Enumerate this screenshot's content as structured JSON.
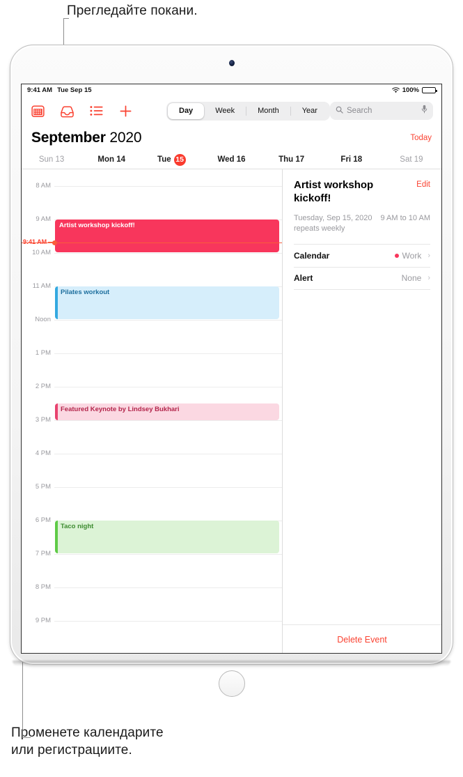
{
  "callouts": {
    "top": "Прегледайте покани.",
    "bottom": "Променете календарите\nили регистрациите."
  },
  "status_bar": {
    "time": "9:41 AM",
    "date": "Tue Sep 15",
    "wifi_icon": "wifi-icon",
    "battery_percent": "100%"
  },
  "toolbar": {
    "icons": [
      {
        "name": "calendars-icon",
        "label": "Calendars"
      },
      {
        "name": "inbox-icon",
        "label": "Inbox"
      },
      {
        "name": "list-icon",
        "label": "List"
      },
      {
        "name": "add-event-icon",
        "label": "Add Event"
      }
    ],
    "segments": [
      {
        "label": "Day",
        "active": true
      },
      {
        "label": "Week",
        "active": false
      },
      {
        "label": "Month",
        "active": false
      },
      {
        "label": "Year",
        "active": false
      }
    ],
    "search": {
      "placeholder": "Search",
      "search_icon": "search-icon",
      "mic_icon": "microphone-icon"
    }
  },
  "header": {
    "month": "September",
    "year": "2020",
    "today_label": "Today"
  },
  "weekdays": [
    {
      "label": "Sun 13",
      "name": "Sun",
      "num": "13",
      "dim": true,
      "selected": false
    },
    {
      "label": "Mon 14",
      "name": "Mon",
      "num": "14",
      "dim": false,
      "selected": false
    },
    {
      "label": "Tue 15",
      "name": "Tue",
      "num": "15",
      "dim": false,
      "selected": true
    },
    {
      "label": "Wed 16",
      "name": "Wed",
      "num": "16",
      "dim": false,
      "selected": false
    },
    {
      "label": "Thu 17",
      "name": "Thu",
      "num": "17",
      "dim": false,
      "selected": false
    },
    {
      "label": "Fri 18",
      "name": "Fri",
      "num": "18",
      "dim": false,
      "selected": false
    },
    {
      "label": "Sat 19",
      "name": "Sat",
      "num": "19",
      "dim": true,
      "selected": false
    }
  ],
  "day_grid": {
    "hours": [
      "8 AM",
      "9 AM",
      "10 AM",
      "11 AM",
      "Noon",
      "1 PM",
      "2 PM",
      "3 PM",
      "4 PM",
      "5 PM",
      "6 PM",
      "7 PM",
      "8 PM",
      "9 PM"
    ],
    "now_marker": {
      "label": "9:41 AM",
      "color": "#FA5C3C"
    },
    "events": [
      {
        "title": "Artist workshop kickoff!",
        "start": "9 AM",
        "end": "10 AM",
        "style": "selected",
        "fill": "#F8365C",
        "accent": "#F8365C"
      },
      {
        "title": "Pilates workout",
        "start": "11 AM",
        "end": "Noon",
        "style": "blue",
        "fill": "#D6EEFB",
        "accent": "#34A9E0"
      },
      {
        "title": "Featured Keynote by Lindsey Bukhari",
        "start": "2:30 PM",
        "end": "3 PM",
        "style": "pink",
        "fill": "#FBD8E2",
        "accent": "#E8436F"
      },
      {
        "title": "Taco night",
        "start": "6 PM",
        "end": "7 PM",
        "style": "green",
        "fill": "#DCF3D6",
        "accent": "#5FCB47"
      }
    ]
  },
  "detail": {
    "title": "Artist workshop kickoff!",
    "edit_label": "Edit",
    "date_text": "Tuesday, Sep 15, 2020",
    "time_text": "9 AM to 10 AM",
    "repeat_text": "repeats weekly",
    "rows": [
      {
        "label": "Calendar",
        "value": "Work",
        "has_dot": true,
        "dot_color": "#F8365C"
      },
      {
        "label": "Alert",
        "value": "None",
        "has_dot": false
      }
    ],
    "delete_label": "Delete Event"
  }
}
